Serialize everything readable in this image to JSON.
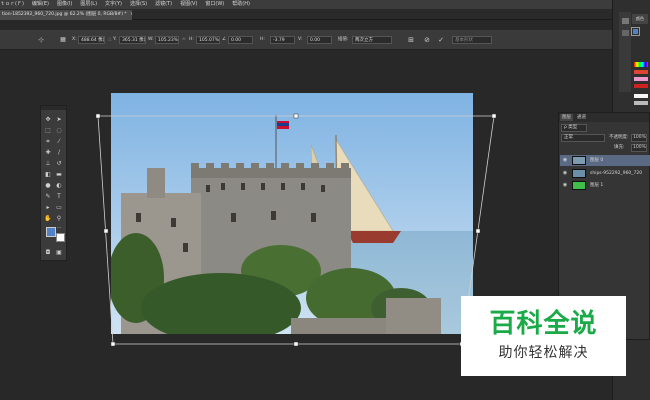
{
  "menubar": {
    "items": [
      "ｔｏｒ(Ｆ)",
      "编辑(E)",
      "图像(I)",
      "图层(L)",
      "文字(Y)",
      "选择(S)",
      "滤镜(T)",
      "视图(V)",
      "窗口(W)",
      "帮助(H)"
    ]
  },
  "document": {
    "tab_title": "tion-1852392_960_720.jpg @ 62.2% (图层 0, RGB/8#) *",
    "tab_close": "×"
  },
  "options": {
    "x_label": "X:",
    "x_value": "488.64 像素",
    "y_label": "Y:",
    "y_value": "365.31 像素",
    "w_label": "W:",
    "w_value": "105.23%",
    "h_label": "H:",
    "h_value": "105.07%",
    "angle_value": "0.00",
    "hskew_label": "H:",
    "hskew_value": "-3.79",
    "vskew_label": "V:",
    "vskew_value": "0.00",
    "interp_label": "插值:",
    "interp_value": "两次立方",
    "mode_value": "基本形状",
    "cancel_glyph": "⊘",
    "commit_glyph": "✓"
  },
  "dock": {
    "color_tab": "颜色",
    "fg_color": "#4f83c6",
    "bg_color": "#ffffff"
  },
  "layers_panel": {
    "tab_layers": "图层",
    "tab_channels": "通道",
    "blend_mode": "正常",
    "opacity_label": "不透明度:",
    "opacity_value": "100%",
    "fill_label": "填充:",
    "fill_value": "100%",
    "layers": [
      {
        "name": "图层 0",
        "selected": true,
        "thumb": "photo"
      },
      {
        "name": "ships-952292_960_720",
        "selected": false,
        "thumb": "photo"
      },
      {
        "name": "图层 1",
        "selected": false,
        "thumb": "#3fbf4a"
      }
    ]
  },
  "watermark": {
    "title": "百科全说",
    "subtitle": "助你轻松解决",
    "title_color": "#1aaa48"
  }
}
